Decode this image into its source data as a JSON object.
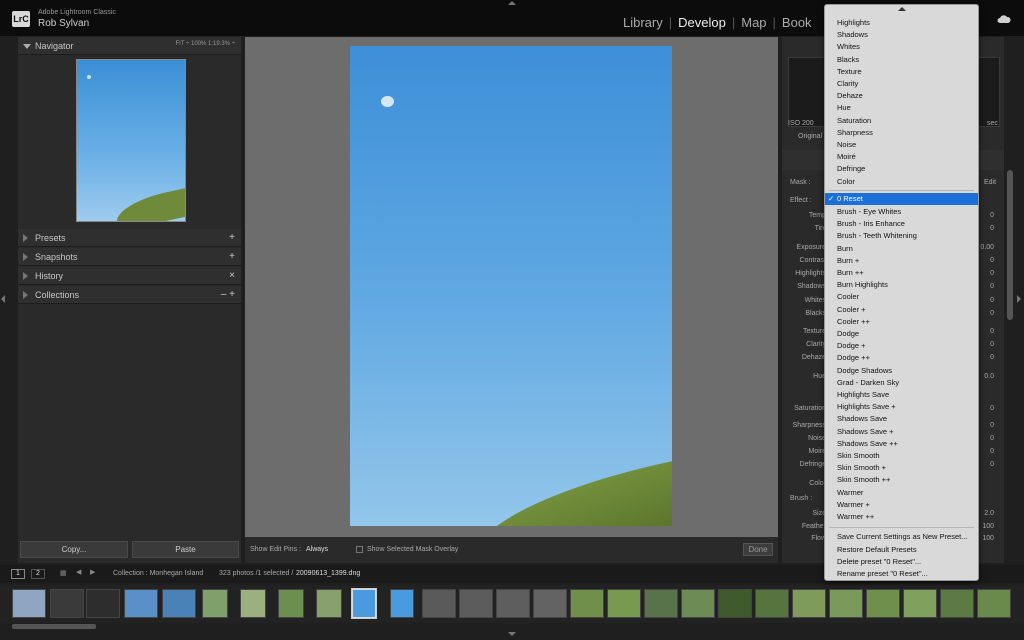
{
  "window": {
    "app_small_title": "Adobe Lightroom Classic",
    "user": "Rob Sylvan",
    "logo": "LrC"
  },
  "modules": [
    "Library",
    "Develop",
    "Map",
    "Book"
  ],
  "module_active": "Develop",
  "navigator": {
    "title": "Navigator",
    "zoom_options": "FIT ÷   100%   1:19.3% ÷"
  },
  "left_panels": [
    {
      "name": "Presets",
      "action": "+"
    },
    {
      "name": "Snapshots",
      "action": "+"
    },
    {
      "name": "History",
      "action": "×"
    },
    {
      "name": "Collections",
      "action": "– +"
    }
  ],
  "left_buttons": {
    "copy": "Copy...",
    "paste": "Paste"
  },
  "center_toolbar": {
    "show_pins_label": "Show Edit Pins :",
    "show_pins_value": "Always",
    "overlay_label": "Show Selected Mask Overlay",
    "done": "Done"
  },
  "right_panel": {
    "iso": "ISO 200",
    "sec": "sec",
    "original": "Original",
    "mask": "Mask :",
    "edit": "Edit",
    "effect": "Effect :",
    "brush": "Brush :",
    "sliders": [
      {
        "label": "Temp",
        "value": "0"
      },
      {
        "label": "Tint",
        "value": "0"
      },
      {
        "label": "Exposure",
        "value": "0.00"
      },
      {
        "label": "Contrast",
        "value": "0"
      },
      {
        "label": "Highlights",
        "value": "0"
      },
      {
        "label": "Shadows",
        "value": "0"
      },
      {
        "label": "Whites",
        "value": "0"
      },
      {
        "label": "Blacks",
        "value": "0"
      },
      {
        "label": "Texture",
        "value": "0"
      },
      {
        "label": "Clarity",
        "value": "0"
      },
      {
        "label": "Dehaze",
        "value": "0"
      },
      {
        "label": "Hue",
        "value": "0.0"
      },
      {
        "label": "Saturation",
        "value": "0"
      },
      {
        "label": "Sharpness",
        "value": "0"
      },
      {
        "label": "Noise",
        "value": "0"
      },
      {
        "label": "Moiré",
        "value": "0"
      },
      {
        "label": "Defringe",
        "value": "0"
      },
      {
        "label": "Color",
        "value": ""
      }
    ],
    "brush_values": [
      {
        "label": "Size",
        "value": "2.0"
      },
      {
        "label": "Feather",
        "value": "100"
      },
      {
        "label": "Flow",
        "value": "100"
      }
    ]
  },
  "filmbar": {
    "page1": "1",
    "page2": "2",
    "collection": "Collection : Monhegan Island",
    "count": "323 photos /1 selected /",
    "filename": "20090613_1399.dng"
  },
  "dropdown": {
    "top_items": [
      "Highlights",
      "Shadows",
      "Whites",
      "Blacks",
      "Texture",
      "Clarity",
      "Dehaze",
      "Hue",
      "Saturation",
      "Sharpness",
      "Noise",
      "Moiré",
      "Defringe",
      "Color"
    ],
    "selected": "0 Reset",
    "presets": [
      "Brush - Eye Whites",
      "Brush - Iris Enhance",
      "Brush - Teeth Whitening",
      "Burn",
      "Burn +",
      "Burn ++",
      "Burn Highlights",
      "Cooler",
      "Cooler +",
      "Cooler ++",
      "Dodge",
      "Dodge +",
      "Dodge ++",
      "Dodge Shadows",
      "Grad - Darken Sky",
      "Highlights Save",
      "Highlights Save +",
      "Shadows Save",
      "Shadows Save +",
      "Shadows Save ++",
      "Skin Smooth",
      "Skin Smooth +",
      "Skin Smooth ++",
      "Warmer",
      "Warmer +",
      "Warmer ++"
    ],
    "actions": [
      "Save Current Settings as New Preset...",
      "Restore Default Presets",
      "Delete preset \"0 Reset\"...",
      "Rename preset \"0 Reset\"..."
    ]
  },
  "colors": {
    "accent": "#1b6fd6",
    "sky": "#4a9ae0",
    "grass": "#6f8a3a"
  }
}
